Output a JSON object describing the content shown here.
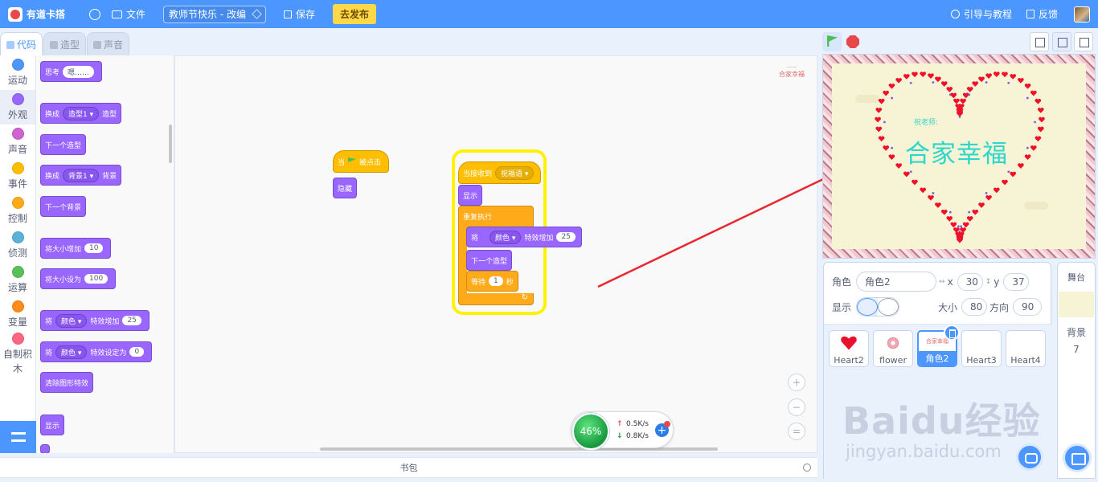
{
  "topbar": {
    "brand": "有道卡搭",
    "file_menu": "文件",
    "project_title": "教师节快乐 - 改编",
    "save": "保存",
    "publish": "去发布",
    "guide": "引导与教程",
    "feedback": "反馈"
  },
  "tabs": [
    {
      "label": "代码",
      "icon": "code-icon",
      "active": true
    },
    {
      "label": "造型",
      "icon": "brush-icon",
      "active": false
    },
    {
      "label": "声音",
      "icon": "speaker-icon",
      "active": false
    }
  ],
  "categories": [
    {
      "label": "运动",
      "color": "#4c97ff"
    },
    {
      "label": "外观",
      "color": "#9966ff"
    },
    {
      "label": "声音",
      "color": "#cf63cf"
    },
    {
      "label": "事件",
      "color": "#ffbf00"
    },
    {
      "label": "控制",
      "color": "#ffab19"
    },
    {
      "label": "侦测",
      "color": "#5cb1d6"
    },
    {
      "label": "运算",
      "color": "#59c059"
    },
    {
      "label": "变量",
      "color": "#ff8c1a"
    },
    {
      "label": "自制积木",
      "color": "#ff6680"
    }
  ],
  "palette": {
    "think": "思考",
    "think_value": "嗯……",
    "switch_costume": "换成",
    "costume_value": "造型1",
    "costume_suffix": "造型",
    "next_costume": "下一个造型",
    "switch_backdrop": "换成",
    "backdrop_value": "背景1",
    "backdrop_suffix": "背景",
    "next_backdrop": "下一个背景",
    "change_size": "将大小增加",
    "change_size_value": "10",
    "set_size": "将大小设为",
    "set_size_value": "100",
    "effect_change_prefix": "将",
    "effect_value": "颜色",
    "effect_change": "特效增加",
    "effect_change_value": "25",
    "effect_set_prefix": "将",
    "effect_set": "特效设定为",
    "effect_set_value": "0",
    "clear_effects": "清除图形特效",
    "show": "显示"
  },
  "code": {
    "script1": {
      "hat_when": "当",
      "hat_clicked": "被点击",
      "hide": "隐藏"
    },
    "script2": {
      "hat": "当接收到",
      "message": "祝福语",
      "show": "显示",
      "forever": "重复执行",
      "change_prefix": "将",
      "effect": "颜色",
      "change": "特效增加",
      "change_value": "25",
      "next_costume": "下一个造型",
      "wait": "等待",
      "wait_value": "1",
      "wait_unit": "秒"
    },
    "corner_thumb_text": "合家幸福"
  },
  "bookbag": "书包",
  "network": {
    "percent": "46%",
    "upload": "0.5K/s",
    "download": "0.8K/s"
  },
  "stage": {
    "blessing": "祝老师:",
    "title": "合家幸福",
    "heart_color": "#f0102a",
    "accent_color": "#7b5cf0"
  },
  "sprite_info": {
    "sprite_label": "角色",
    "sprite_name": "角色2",
    "x_label": "x",
    "x": "30",
    "y_label": "y",
    "y": "37",
    "show_label": "显示",
    "size_label": "大小",
    "size": "80",
    "direction_label": "方向",
    "direction": "90"
  },
  "sprites": [
    {
      "name": "Heart2",
      "thumb": "heart"
    },
    {
      "name": "flower",
      "thumb": "flower"
    },
    {
      "name": "角色2",
      "thumb": "text",
      "selected": true
    },
    {
      "name": "Heart3",
      "thumb": "none"
    },
    {
      "name": "Heart4",
      "thumb": "none"
    }
  ],
  "backdrop": {
    "title": "舞台",
    "label": "背景",
    "count": "7"
  },
  "watermark": {
    "big": "Baidu经验",
    "small": "jingyan.baidu.com"
  }
}
